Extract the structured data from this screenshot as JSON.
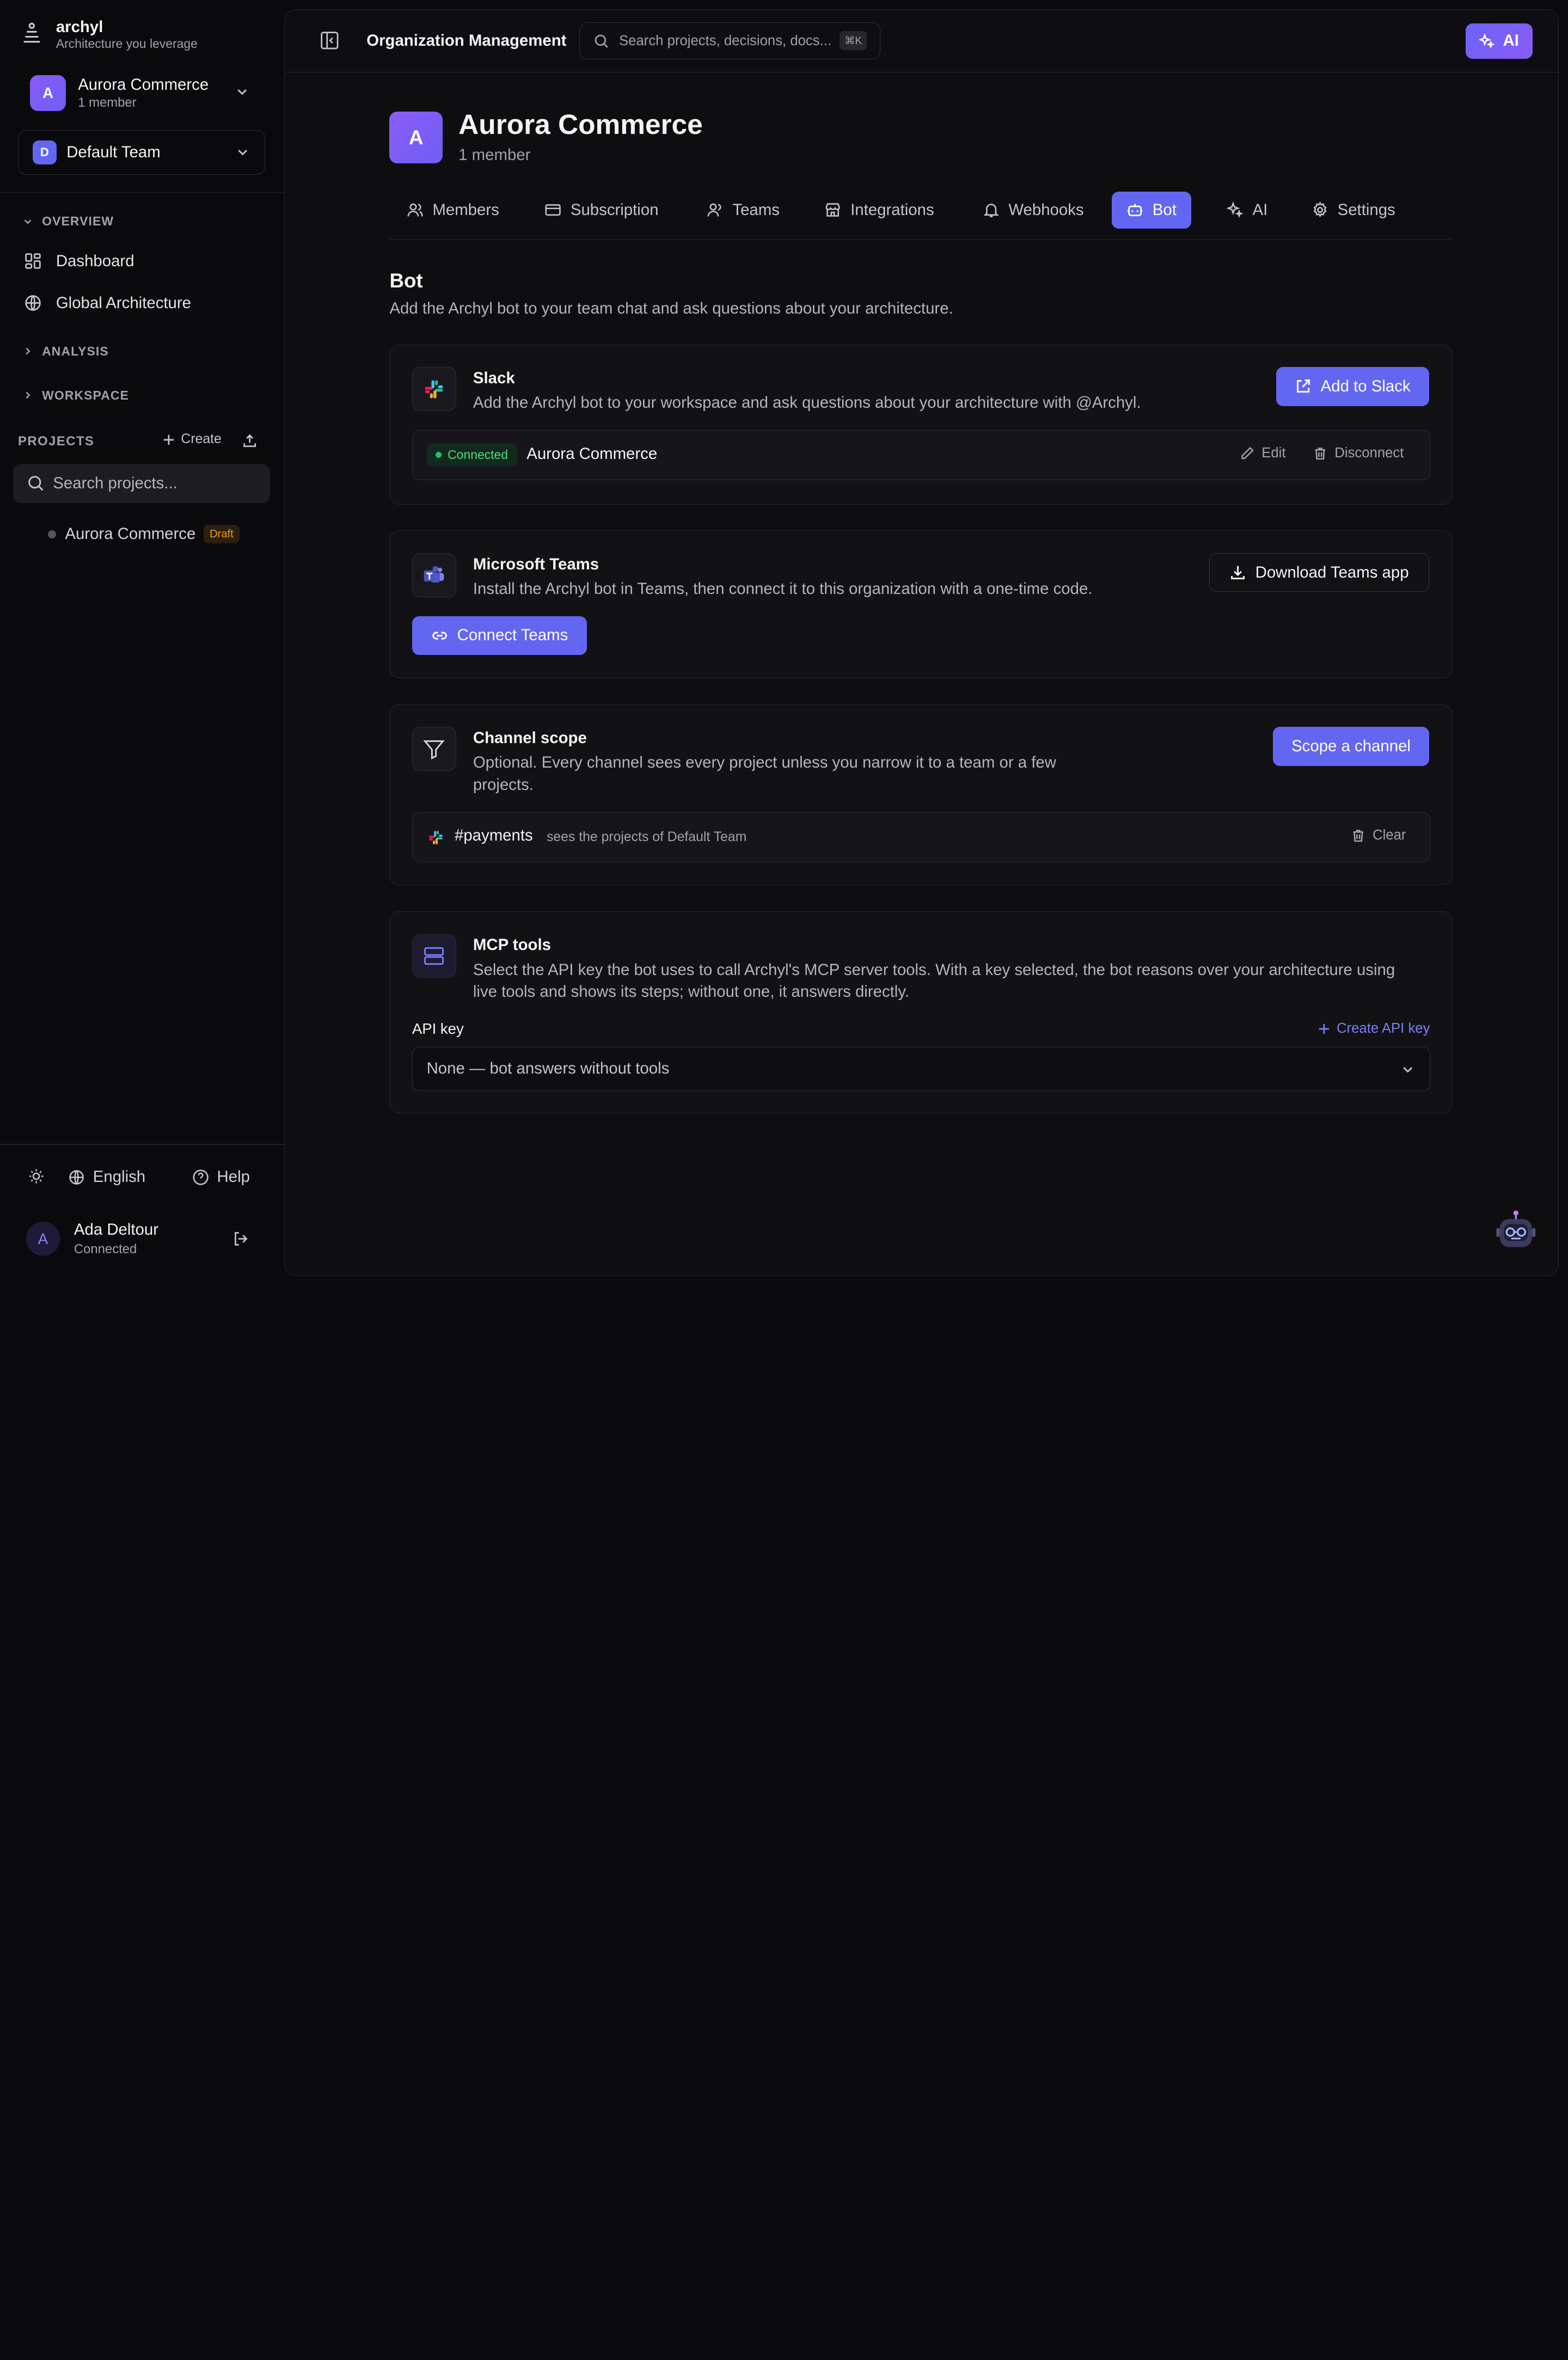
{
  "brand": {
    "name": "archyl",
    "tagline": "Architecture you leverage"
  },
  "org_switcher": {
    "initial": "A",
    "name": "Aurora Commerce",
    "members": "1 member"
  },
  "team_select": {
    "initial": "D",
    "name": "Default Team"
  },
  "sidebar": {
    "overview_label": "OVERVIEW",
    "items": [
      {
        "label": "Dashboard",
        "icon": "dashboard-icon"
      },
      {
        "label": "Global Architecture",
        "icon": "globe-icon"
      }
    ],
    "analysis_label": "ANALYSIS",
    "workspace_label": "WORKSPACE",
    "projects_label": "PROJECTS",
    "create_label": "Create",
    "search_placeholder": "Search projects...",
    "projects": [
      {
        "name": "Aurora Commerce",
        "badge": "Draft"
      }
    ]
  },
  "footer": {
    "language": "English",
    "help": "Help",
    "user": {
      "initial": "A",
      "name": "Ada Deltour",
      "status": "Connected"
    }
  },
  "topbar": {
    "title": "Organization Management",
    "search_placeholder": "Search projects, decisions, docs...",
    "shortcut": "⌘K",
    "ai_label": "AI"
  },
  "org_header": {
    "initial": "A",
    "name": "Aurora Commerce",
    "members": "1 member"
  },
  "tabs": [
    {
      "label": "Members",
      "icon": "users-icon",
      "active": false
    },
    {
      "label": "Subscription",
      "icon": "credit-card-icon",
      "active": false
    },
    {
      "label": "Teams",
      "icon": "team-icon",
      "active": false
    },
    {
      "label": "Integrations",
      "icon": "store-icon",
      "active": false
    },
    {
      "label": "Webhooks",
      "icon": "bell-icon",
      "active": false
    },
    {
      "label": "Bot",
      "icon": "bot-icon",
      "active": true
    },
    {
      "label": "AI",
      "icon": "sparkles-icon",
      "active": false
    },
    {
      "label": "Settings",
      "icon": "gear-icon",
      "active": false
    }
  ],
  "bot_section": {
    "title": "Bot",
    "description": "Add the Archyl bot to your team chat and ask questions about your architecture."
  },
  "slack": {
    "title": "Slack",
    "description": "Add the Archyl bot to your workspace and ask questions about your architecture with @Archyl.",
    "button": "Add to Slack",
    "connection": {
      "status": "Connected",
      "workspace": "Aurora Commerce",
      "edit": "Edit",
      "disconnect": "Disconnect"
    }
  },
  "teams": {
    "title": "Microsoft Teams",
    "description": "Install the Archyl bot in Teams, then connect it to this organization with a one-time code.",
    "download_button": "Download Teams app",
    "connect_button": "Connect Teams"
  },
  "channel_scope": {
    "title": "Channel scope",
    "description_line1": "Optional. Every channel sees every project unless you narrow it to a team or a few",
    "description_line2": "projects.",
    "button": "Scope a channel",
    "scoped": {
      "channel": "#payments",
      "detail": "sees the projects of Default Team",
      "clear": "Clear"
    }
  },
  "mcp": {
    "title": "MCP tools",
    "description_line1": "Select the API key the bot uses to call Archyl's MCP server tools. With a key selected, the bot reasons over your architecture using",
    "description_line2": "live tools and shows its steps; without one, it answers directly.",
    "api_key_label": "API key",
    "create_api_key": "Create API key",
    "selected": "None — bot answers without tools"
  },
  "colors": {
    "accent": "#6366f1",
    "connected": "#22c55e",
    "draft": "#f59e0b",
    "background": "#0a0a0c"
  }
}
